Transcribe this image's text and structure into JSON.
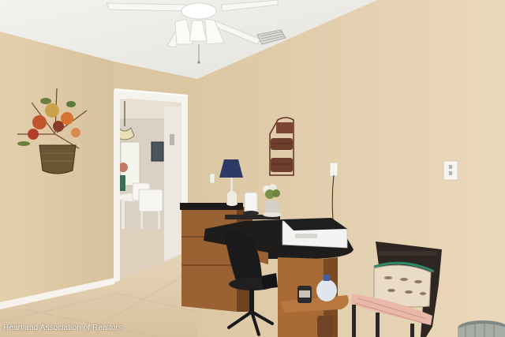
{
  "photo": {
    "watermark": "Heartland Association of Realtors",
    "colors": {
      "wall": "#e6d2b2",
      "wall_shadow": "#d9c3a0",
      "ceiling": "#efeeea",
      "floor": "#e3cfb2",
      "baseboard": "#f5f1e8",
      "desk_top": "#1c1a1a",
      "desk_wood": "#9a6232"
    }
  }
}
